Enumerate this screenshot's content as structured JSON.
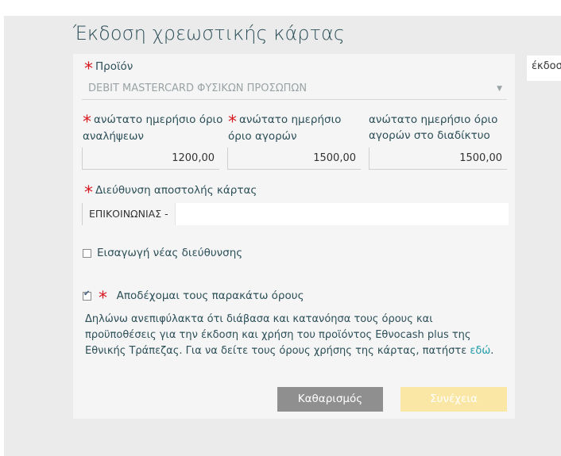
{
  "page": {
    "title": "Έκδοση χρεωστικής κάρτας",
    "side_note": "έκδοσ"
  },
  "form": {
    "product_label": "Προϊόν",
    "product_value": "DEBIT MASTERCARD ΦΥΣΙΚΩΝ ΠΡΟΣΩΠΩΝ",
    "limits": [
      {
        "label_1": "ανώτατο ημερήσιο όριο",
        "label_2": "αναλήψεων",
        "value": "1200,00",
        "required": true
      },
      {
        "label_1": "ανώτατο ημερήσιο",
        "label_2": "όριο αγορών",
        "value": "1500,00",
        "required": true
      },
      {
        "label_1": "ανώτατο ημερήσιο όριο",
        "label_2": "αγορών στο διαδίκτυο",
        "value": "1500,00",
        "required": false
      }
    ],
    "address_label": "Διεύθυνση αποστολής κάρτας",
    "address_prefix": "ΕΠΙΚΟΙΝΩΝΙΑΣ -",
    "new_address_label": "Εισαγωγή νέας διεύθυνσης",
    "new_address_checked": false,
    "accept_terms_label": "Αποδέχομαι τους παρακάτω όρους",
    "accept_terms_checked": true,
    "terms_text": "Δηλώνω ανεπιφύλακτα ότι διάβασα και κατανόησα τους όρους και προϋποθέσεις για την έκδοση και χρήση του προϊόντος Εθνocash plus της Εθνικής Τράπεζας. Για να δείτε τους όρους χρήσης της κάρτας, πατήστε",
    "terms_link": "εδώ",
    "terms_end": "."
  },
  "buttons": {
    "clear": "Καθαρισμός",
    "continue": "Συνέχεια"
  },
  "colors": {
    "required": "#d71920",
    "link": "#1f9aa8",
    "continue_disabled": "#fae7a6",
    "clear_bg": "#8f8f8f"
  }
}
